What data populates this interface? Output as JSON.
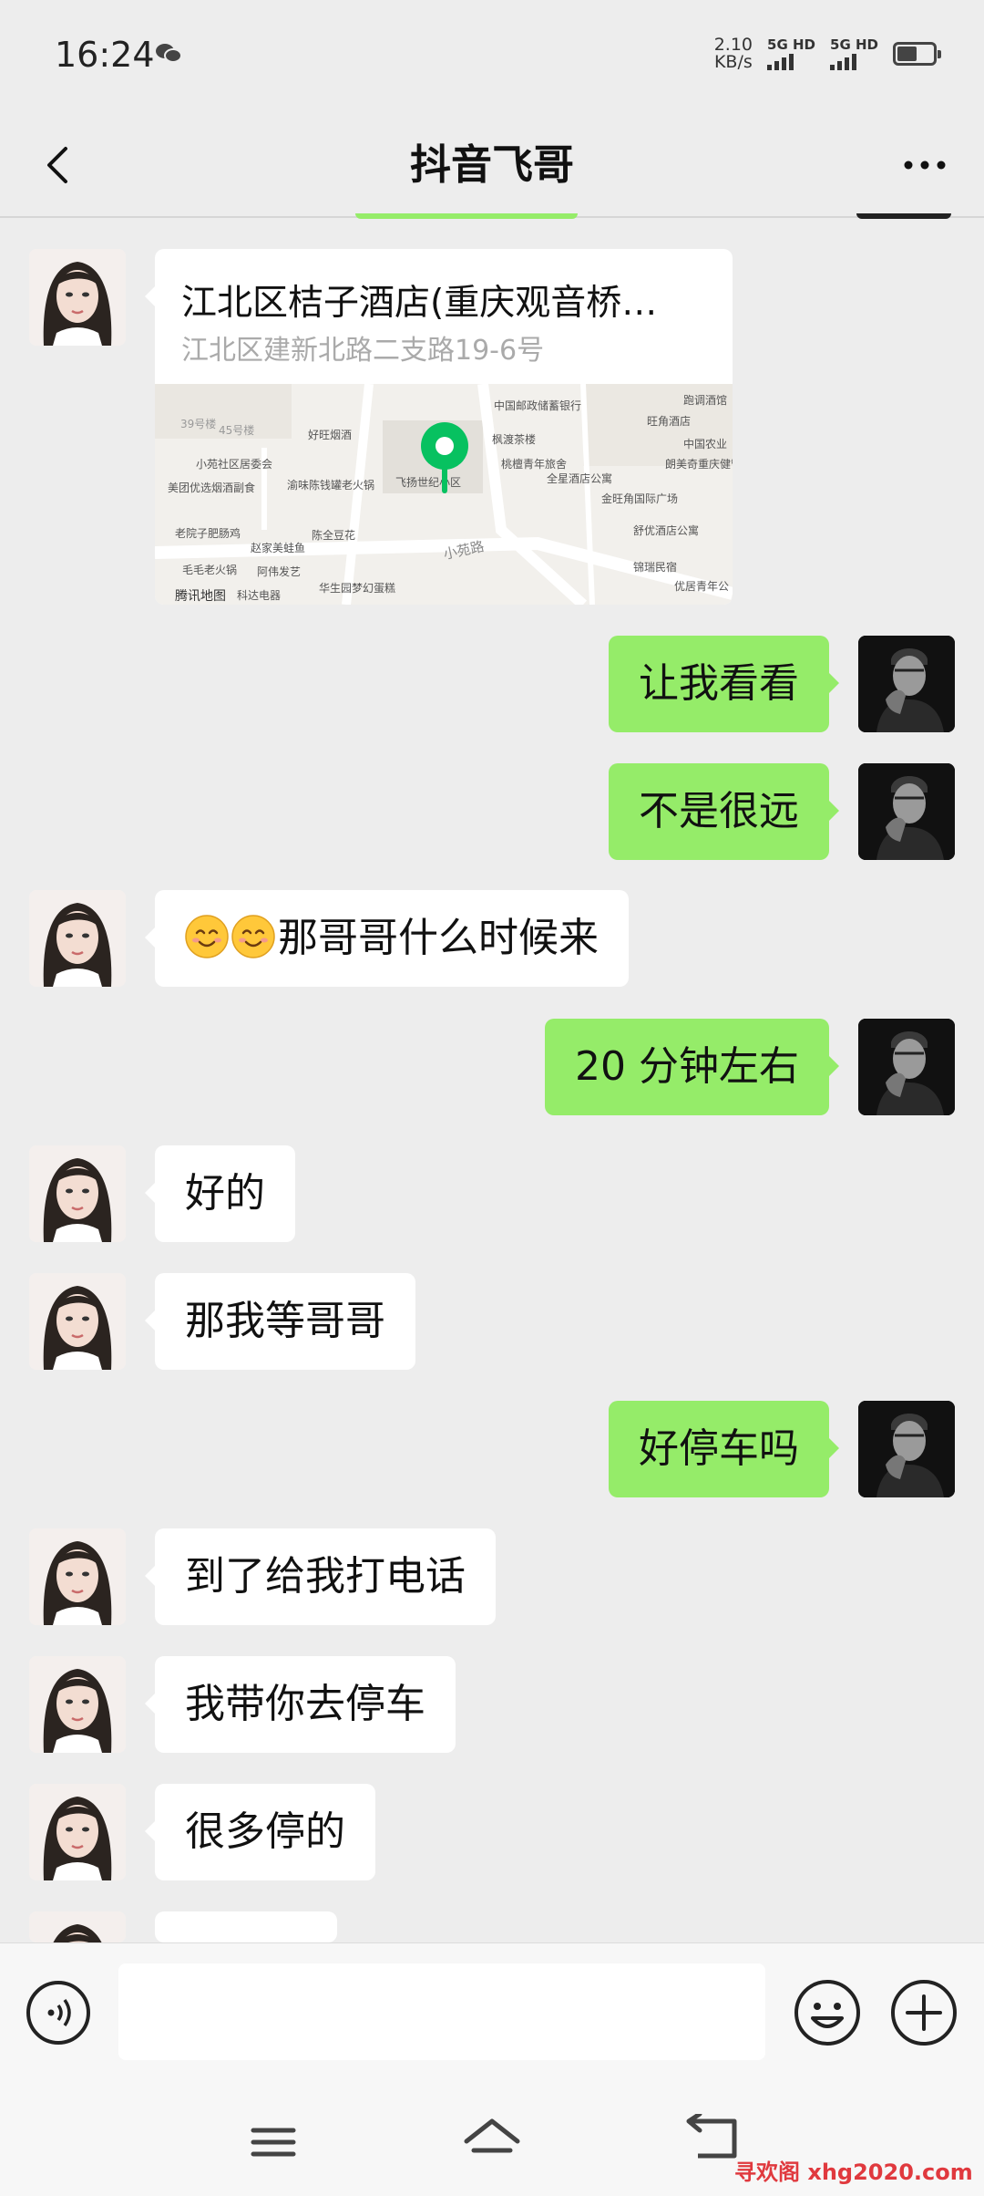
{
  "status": {
    "time": "16:24",
    "net_speed": "2.10",
    "net_unit": "KB/s",
    "sim1": "5G HD",
    "sim2": "5G HD",
    "battery_level": 0.55
  },
  "header": {
    "title": "抖音飞哥"
  },
  "location": {
    "title": "江北区桔子酒店(重庆观音桥…",
    "address": "江北区建新北路二支路19-6号",
    "map_labels": {
      "bank": "中国邮政储蓄银行",
      "restaurant1": "好旺烟酒",
      "community": "小苑社区居委会",
      "hotpot": "渝味陈钱罐老火锅",
      "poi_main": "飞扬世纪小区",
      "tea": "枫渡茶楼",
      "hotel": "桃檀青年旅舍",
      "apt": "全星酒店公寓",
      "food": "美团优选烟酒副食",
      "noodle": "老院子肥肠鸡",
      "fish": "赵家美蛙鱼",
      "bean": "陈全豆花",
      "road": "小苑路",
      "tongue": "毛毛老火锅",
      "hair": "阿伟发艺",
      "kede": "科达电器",
      "bakery": "华生园梦幻蛋糕",
      "bldg39": "39号楼",
      "bldg45": "45号楼",
      "plaza": "金旺角国际广场",
      "hotel2": "舒优酒店公寓",
      "inn": "锦瑞民宿",
      "youth": "优居青年公",
      "wang": "旺角酒店",
      "agri": "中国农业",
      "restaurant2": "跑调酒馆",
      "health": "朗美奇重庆健管理有公司",
      "brand": "腾讯地图"
    }
  },
  "messages": [
    {
      "side": "out",
      "text": "让我看看"
    },
    {
      "side": "out",
      "text": "不是很远"
    },
    {
      "side": "in",
      "emoji": [
        "smiling-face",
        "smiling-face"
      ],
      "text": "那哥哥什么时候来"
    },
    {
      "side": "out",
      "text": "20 分钟左右"
    },
    {
      "side": "in",
      "text": "好的"
    },
    {
      "side": "in",
      "text": "那我等哥哥"
    },
    {
      "side": "out",
      "text": "好停车吗"
    },
    {
      "side": "in",
      "text": "到了给我打电话"
    },
    {
      "side": "in",
      "text": "我带你去停车"
    },
    {
      "side": "in",
      "text": "很多停的"
    }
  ],
  "input": {
    "placeholder": ""
  },
  "icons": {
    "back": "chevron-left-icon",
    "more": "more-icon",
    "voice": "voice-icon",
    "emoji": "emoji-icon",
    "plus": "plus-icon",
    "nav_menu": "menu-icon",
    "nav_home": "home-icon",
    "nav_back": "back-icon",
    "pin": "map-pin-icon"
  },
  "colors": {
    "background": "#ededed",
    "outgoing_bubble": "#95ec69",
    "incoming_bubble": "#ffffff",
    "pin": "#07c160",
    "watermark": "#e0393e"
  },
  "watermark": "寻欢阁 xhg2020.com"
}
